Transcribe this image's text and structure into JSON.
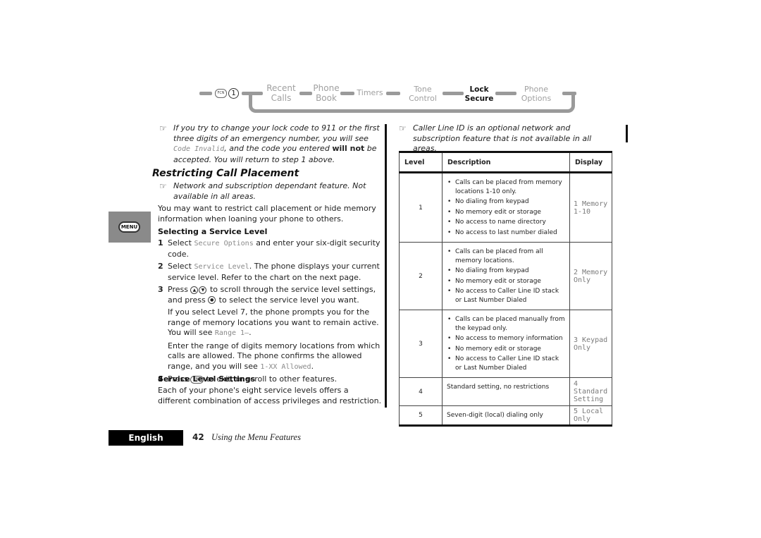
{
  "nav": {
    "fcn_key": "FCN",
    "one_key": "1",
    "items": [
      {
        "line1": "Recent",
        "line2": "Calls",
        "active": false
      },
      {
        "line1": "Phone",
        "line2": "Book",
        "active": false
      },
      {
        "line1": "Timers",
        "line2": "",
        "active": false
      },
      {
        "line1": "Tone",
        "line2": "Control",
        "active": false
      },
      {
        "line1": "Lock",
        "line2": "Secure",
        "active": true
      },
      {
        "line1": "Phone",
        "line2": "Options",
        "active": false
      }
    ]
  },
  "left": {
    "note1": {
      "icon": "pointing-hand-icon",
      "text_a": "If you try to change your lock code to 911 or the first three digits of an emergency number, you will see ",
      "lcd": "Code Invalid",
      "text_b": ", and the code you entered ",
      "bold": "will not",
      "text_c": " be accepted. You will return to step 1 above."
    },
    "heading": "Restricting Call Placement",
    "note2": "Network and subscription dependant feature. Not available in all areas.",
    "intro": "You may want to restrict call placement or hide memory information when loaning your phone to others.",
    "menu_key": "MENU",
    "sub1": "Selecting a Service Level",
    "step1": {
      "num": "1",
      "a": "Select ",
      "lcd": "Secure Options",
      "b": " and enter your six-digit security code."
    },
    "step2": {
      "num": "2",
      "a": "Select ",
      "lcd": "Service Level",
      "b": ". The phone displays your current service level. Refer to the chart on the next page."
    },
    "step3": {
      "num": "3",
      "a": "Press ",
      "b": " to scroll through the service level settings, and press ",
      "c": " to select the service level you want."
    },
    "para_level7": {
      "a": "If you select Level 7, the phone prompts you for the range of memory locations you want to remain active. You will see ",
      "lcd": "Range 1—",
      "b": "."
    },
    "para_range": {
      "a": "Enter the range of digits memory locations from which calls are allowed. The phone confirms the allowed range, and you will see ",
      "lcd": "1-XX Allowed",
      "b": "."
    },
    "step4": {
      "num": "4",
      "a": "Press ",
      "key": "END",
      "b": " to exit, or scroll to other features."
    },
    "sub2": "Service Level Settings",
    "para_settings": "Each of your phone's eight service levels offers a different combination of access privileges and restriction."
  },
  "right": {
    "note": "Caller Line ID is an optional network and subscription feature that is not available in all areas.",
    "table": {
      "headers": [
        "Level",
        "Description",
        "Display"
      ],
      "rows": [
        {
          "level": "1",
          "bullets": [
            "Calls can be placed from memory locations 1-10 only.",
            "No dialing from keypad",
            "No memory edit or storage",
            "No access to name directory",
            "No access to last number dialed"
          ],
          "display": "1 Memory 1-10"
        },
        {
          "level": "2",
          "bullets": [
            "Calls can be placed from all memory locations.",
            "No dialing from keypad",
            "No memory edit or storage",
            "No access to Caller Line ID stack or Last Number Dialed"
          ],
          "display": "2 Memory Only"
        },
        {
          "level": "3",
          "bullets": [
            "Calls can be placed manually from the keypad only.",
            "No access to memory information",
            "No memory edit or storage",
            "No access to Caller Line ID stack or Last Number Dialed"
          ],
          "display": "3 Keypad Only"
        },
        {
          "level": "4",
          "text": "Standard setting, no restrictions",
          "display_l1": "4 Standard",
          "display_l2": "Setting"
        },
        {
          "level": "5",
          "text": "Seven-digit (local) dialing only",
          "display": "5 Local Only"
        }
      ]
    }
  },
  "footer": {
    "language": "English",
    "page_number": "42",
    "section_title": "Using the Menu Features"
  }
}
